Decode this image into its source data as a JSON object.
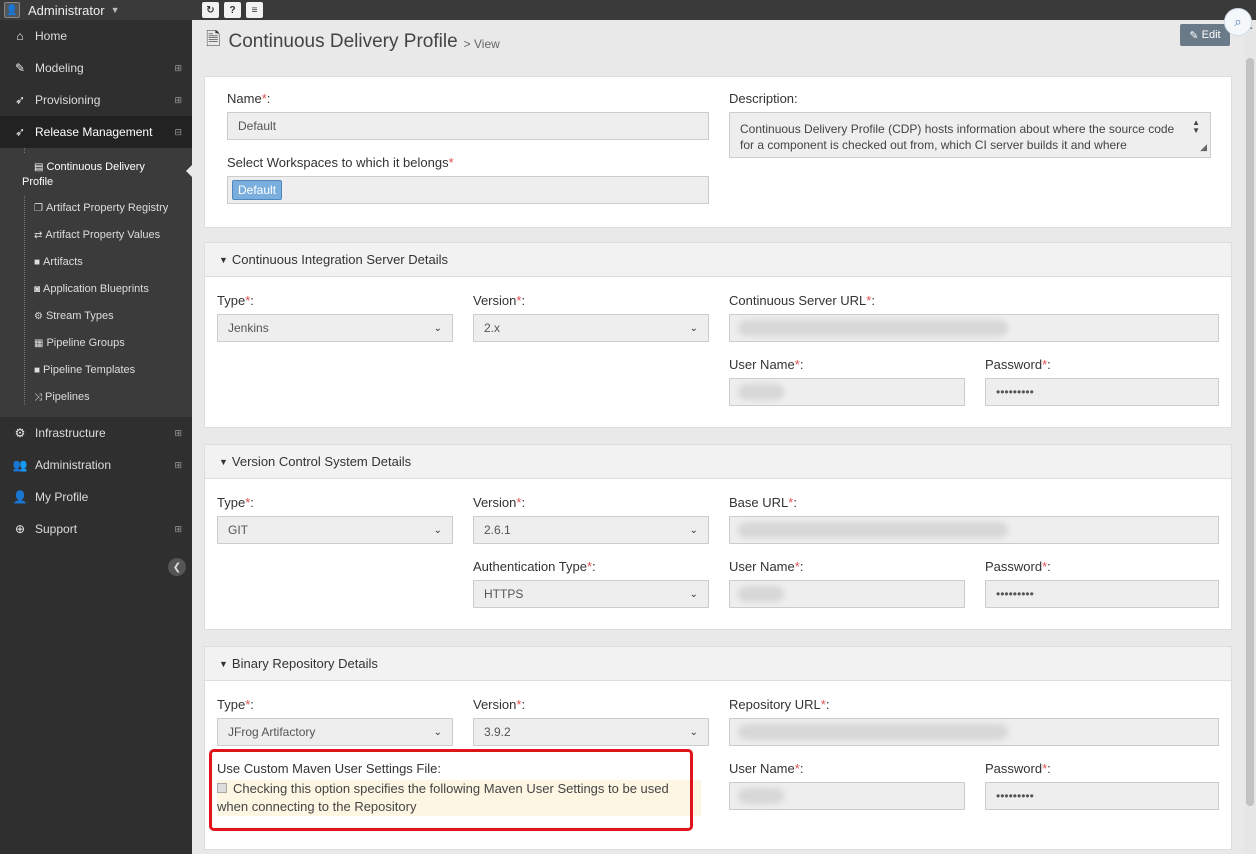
{
  "user": {
    "name": "Administrator"
  },
  "nav": {
    "items": [
      {
        "label": "Home",
        "icon": "home-icon"
      },
      {
        "label": "Modeling",
        "icon": "brush-icon"
      },
      {
        "label": "Provisioning",
        "icon": "rocket-icon"
      },
      {
        "label": "Release Management",
        "icon": "rocket-icon"
      }
    ],
    "sub_items": [
      {
        "label_1": "Continuous Delivery",
        "label_2": "Profile"
      },
      {
        "label": "Artifact Property Registry"
      },
      {
        "label": "Artifact Property Values"
      },
      {
        "label": "Artifacts"
      },
      {
        "label": "Application Blueprints"
      },
      {
        "label": "Stream Types"
      },
      {
        "label": "Pipeline Groups"
      },
      {
        "label": "Pipeline Templates"
      },
      {
        "label": "Pipelines"
      }
    ],
    "lower_items": [
      {
        "label": "Infrastructure"
      },
      {
        "label": "Administration"
      },
      {
        "label": "My Profile"
      },
      {
        "label": "Support"
      }
    ]
  },
  "topbar": {
    "refresh": "↻",
    "help": "?",
    "menu": "≡"
  },
  "page": {
    "title": "Continuous Delivery Profile",
    "subtitle": "> View",
    "edit_label": "Edit"
  },
  "general": {
    "name_label": "Name",
    "name_value": "Default",
    "description_label": "Description:",
    "description_value": "Continuous Delivery Profile (CDP) hosts information about where the source code for a component is checked out from, which CI server builds it and where",
    "workspaces_label": "Select Workspaces to which it belongs",
    "workspace_tag": "Default"
  },
  "ci": {
    "title": "Continuous Integration Server Details",
    "type_label": "Type",
    "type_value": "Jenkins",
    "version_label": "Version",
    "version_value": "2.x",
    "url_label": "Continuous Server URL",
    "user_label": "User Name",
    "password_label": "Password",
    "password_value": "•••••••••"
  },
  "vcs": {
    "title": "Version Control System Details",
    "type_label": "Type",
    "type_value": "GIT",
    "version_label": "Version",
    "version_value": "2.6.1",
    "base_url_label": "Base URL",
    "auth_label": "Authentication Type",
    "auth_value": "HTTPS",
    "user_label": "User Name",
    "password_label": "Password",
    "password_value": "•••••••••"
  },
  "repo": {
    "title": "Binary Repository Details",
    "type_label": "Type",
    "type_value": "JFrog Artifactory",
    "version_label": "Version",
    "version_value": "3.9.2",
    "url_label": "Repository URL",
    "maven_label": "Use Custom Maven User Settings File:",
    "maven_text": "Checking this option specifies the following Maven User Settings to be used when connecting to the Repository",
    "user_label": "User Name",
    "password_label": "Password",
    "password_value": "•••••••••"
  }
}
